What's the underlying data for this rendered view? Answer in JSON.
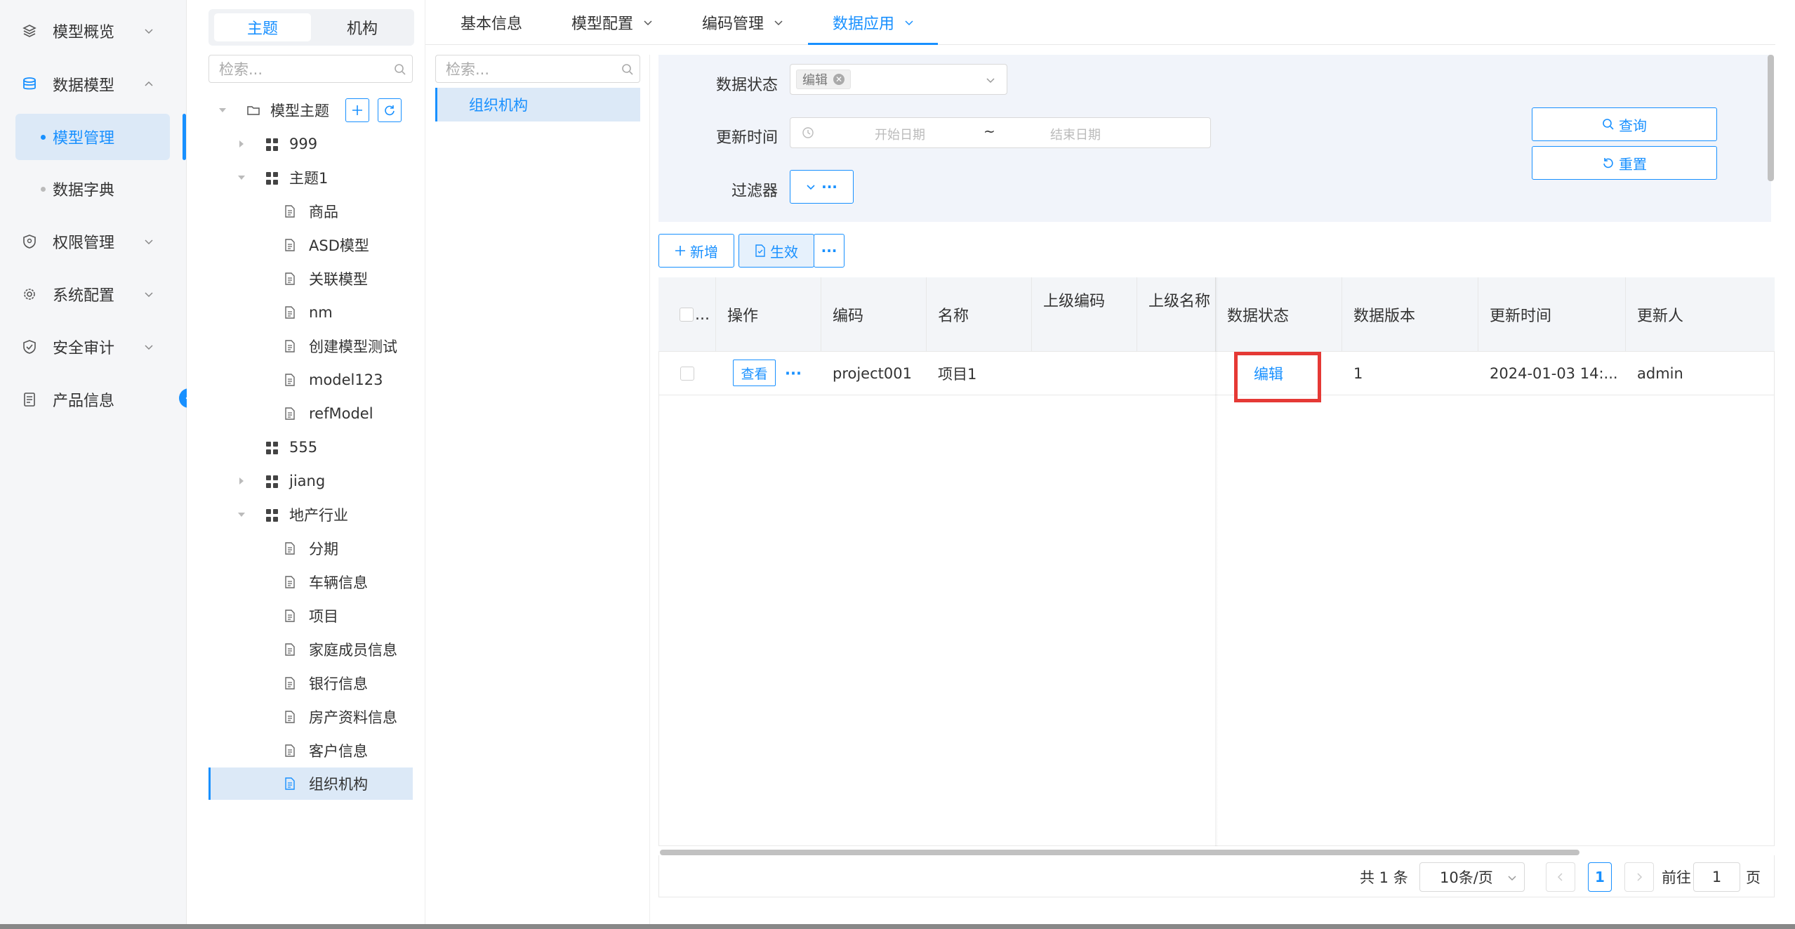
{
  "nav": {
    "items": [
      {
        "label": "模型概览",
        "icon": "layers-icon"
      },
      {
        "label": "数据模型",
        "icon": "database-icon"
      },
      {
        "label": "权限管理",
        "icon": "shield-icon"
      },
      {
        "label": "系统配置",
        "icon": "gear-icon"
      },
      {
        "label": "安全审计",
        "icon": "shield-check-icon"
      },
      {
        "label": "产品信息",
        "icon": "document-icon"
      }
    ],
    "sub_items": [
      {
        "label": "模型管理",
        "active": true
      },
      {
        "label": "数据字典",
        "active": false
      }
    ]
  },
  "tree_panel": {
    "segments": [
      "主题",
      "机构"
    ],
    "search_placeholder": "检索...",
    "root_label": "模型主题",
    "nodes": [
      "999",
      "主题1",
      "商品",
      "ASD模型",
      "关联模型",
      "nm",
      "创建模型测试",
      "model123",
      "refModel",
      "555",
      "jiang",
      "地产行业",
      "分期",
      "车辆信息",
      "项目",
      "家庭成员信息",
      "银行信息",
      "房产资料信息",
      "客户信息",
      "组织机构"
    ]
  },
  "tabs": [
    "基本信息",
    "模型配置",
    "编码管理",
    "数据应用"
  ],
  "org_list": {
    "search_placeholder": "检索...",
    "items": [
      "组织机构"
    ]
  },
  "filter": {
    "status_label": "数据状态",
    "status_tag": "编辑",
    "time_label": "更新时间",
    "start_placeholder": "开始日期",
    "range_sep": "~",
    "end_placeholder": "结束日期",
    "filter_label": "过滤器",
    "filter_more": "···",
    "query": "查询",
    "reset": "重置"
  },
  "toolbar": {
    "add": "新增",
    "activate": "生效",
    "more": "···"
  },
  "table": {
    "select_all_ellipsis": "...",
    "columns": [
      "操作",
      "编码",
      "名称",
      "上级编码",
      "上级名称",
      "数据状态",
      "数据版本",
      "更新时间",
      "更新人"
    ],
    "rows": [
      {
        "view": "查看",
        "more": "···",
        "code": "project001",
        "name": "项目1",
        "parent_code": "",
        "parent_name": "",
        "status": "编辑",
        "version": "1",
        "updated": "2024-01-03 14:...",
        "updater": "admin"
      }
    ]
  },
  "pagination": {
    "total": "共 1 条",
    "page_size": "10条/页",
    "current": "1",
    "goto_prefix": "前往",
    "goto_value": "1",
    "goto_suffix": "页"
  },
  "colors": {
    "accent": "#1890ff",
    "highlight": "#e53935"
  }
}
